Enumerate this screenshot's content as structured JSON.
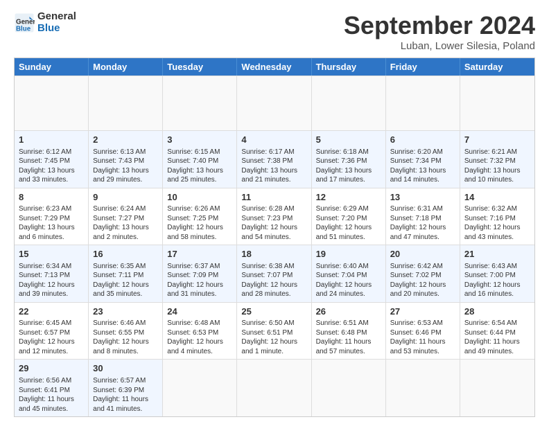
{
  "logo": {
    "line1": "General",
    "line2": "Blue"
  },
  "title": "September 2024",
  "location": "Luban, Lower Silesia, Poland",
  "headers": [
    "Sunday",
    "Monday",
    "Tuesday",
    "Wednesday",
    "Thursday",
    "Friday",
    "Saturday"
  ],
  "rows": [
    [
      {
        "empty": true
      },
      {
        "empty": true
      },
      {
        "empty": true
      },
      {
        "empty": true
      },
      {
        "empty": true
      },
      {
        "empty": true
      },
      {
        "empty": true
      }
    ],
    [
      {
        "day": "1",
        "lines": [
          "Sunrise: 6:12 AM",
          "Sunset: 7:45 PM",
          "Daylight: 13 hours",
          "and 33 minutes."
        ]
      },
      {
        "day": "2",
        "lines": [
          "Sunrise: 6:13 AM",
          "Sunset: 7:43 PM",
          "Daylight: 13 hours",
          "and 29 minutes."
        ]
      },
      {
        "day": "3",
        "lines": [
          "Sunrise: 6:15 AM",
          "Sunset: 7:40 PM",
          "Daylight: 13 hours",
          "and 25 minutes."
        ]
      },
      {
        "day": "4",
        "lines": [
          "Sunrise: 6:17 AM",
          "Sunset: 7:38 PM",
          "Daylight: 13 hours",
          "and 21 minutes."
        ]
      },
      {
        "day": "5",
        "lines": [
          "Sunrise: 6:18 AM",
          "Sunset: 7:36 PM",
          "Daylight: 13 hours",
          "and 17 minutes."
        ]
      },
      {
        "day": "6",
        "lines": [
          "Sunrise: 6:20 AM",
          "Sunset: 7:34 PM",
          "Daylight: 13 hours",
          "and 14 minutes."
        ]
      },
      {
        "day": "7",
        "lines": [
          "Sunrise: 6:21 AM",
          "Sunset: 7:32 PM",
          "Daylight: 13 hours",
          "and 10 minutes."
        ]
      }
    ],
    [
      {
        "day": "8",
        "lines": [
          "Sunrise: 6:23 AM",
          "Sunset: 7:29 PM",
          "Daylight: 13 hours",
          "and 6 minutes."
        ]
      },
      {
        "day": "9",
        "lines": [
          "Sunrise: 6:24 AM",
          "Sunset: 7:27 PM",
          "Daylight: 13 hours",
          "and 2 minutes."
        ]
      },
      {
        "day": "10",
        "lines": [
          "Sunrise: 6:26 AM",
          "Sunset: 7:25 PM",
          "Daylight: 12 hours",
          "and 58 minutes."
        ]
      },
      {
        "day": "11",
        "lines": [
          "Sunrise: 6:28 AM",
          "Sunset: 7:23 PM",
          "Daylight: 12 hours",
          "and 54 minutes."
        ]
      },
      {
        "day": "12",
        "lines": [
          "Sunrise: 6:29 AM",
          "Sunset: 7:20 PM",
          "Daylight: 12 hours",
          "and 51 minutes."
        ]
      },
      {
        "day": "13",
        "lines": [
          "Sunrise: 6:31 AM",
          "Sunset: 7:18 PM",
          "Daylight: 12 hours",
          "and 47 minutes."
        ]
      },
      {
        "day": "14",
        "lines": [
          "Sunrise: 6:32 AM",
          "Sunset: 7:16 PM",
          "Daylight: 12 hours",
          "and 43 minutes."
        ]
      }
    ],
    [
      {
        "day": "15",
        "lines": [
          "Sunrise: 6:34 AM",
          "Sunset: 7:13 PM",
          "Daylight: 12 hours",
          "and 39 minutes."
        ]
      },
      {
        "day": "16",
        "lines": [
          "Sunrise: 6:35 AM",
          "Sunset: 7:11 PM",
          "Daylight: 12 hours",
          "and 35 minutes."
        ]
      },
      {
        "day": "17",
        "lines": [
          "Sunrise: 6:37 AM",
          "Sunset: 7:09 PM",
          "Daylight: 12 hours",
          "and 31 minutes."
        ]
      },
      {
        "day": "18",
        "lines": [
          "Sunrise: 6:38 AM",
          "Sunset: 7:07 PM",
          "Daylight: 12 hours",
          "and 28 minutes."
        ]
      },
      {
        "day": "19",
        "lines": [
          "Sunrise: 6:40 AM",
          "Sunset: 7:04 PM",
          "Daylight: 12 hours",
          "and 24 minutes."
        ]
      },
      {
        "day": "20",
        "lines": [
          "Sunrise: 6:42 AM",
          "Sunset: 7:02 PM",
          "Daylight: 12 hours",
          "and 20 minutes."
        ]
      },
      {
        "day": "21",
        "lines": [
          "Sunrise: 6:43 AM",
          "Sunset: 7:00 PM",
          "Daylight: 12 hours",
          "and 16 minutes."
        ]
      }
    ],
    [
      {
        "day": "22",
        "lines": [
          "Sunrise: 6:45 AM",
          "Sunset: 6:57 PM",
          "Daylight: 12 hours",
          "and 12 minutes."
        ]
      },
      {
        "day": "23",
        "lines": [
          "Sunrise: 6:46 AM",
          "Sunset: 6:55 PM",
          "Daylight: 12 hours",
          "and 8 minutes."
        ]
      },
      {
        "day": "24",
        "lines": [
          "Sunrise: 6:48 AM",
          "Sunset: 6:53 PM",
          "Daylight: 12 hours",
          "and 4 minutes."
        ]
      },
      {
        "day": "25",
        "lines": [
          "Sunrise: 6:50 AM",
          "Sunset: 6:51 PM",
          "Daylight: 12 hours",
          "and 1 minute."
        ]
      },
      {
        "day": "26",
        "lines": [
          "Sunrise: 6:51 AM",
          "Sunset: 6:48 PM",
          "Daylight: 11 hours",
          "and 57 minutes."
        ]
      },
      {
        "day": "27",
        "lines": [
          "Sunrise: 6:53 AM",
          "Sunset: 6:46 PM",
          "Daylight: 11 hours",
          "and 53 minutes."
        ]
      },
      {
        "day": "28",
        "lines": [
          "Sunrise: 6:54 AM",
          "Sunset: 6:44 PM",
          "Daylight: 11 hours",
          "and 49 minutes."
        ]
      }
    ],
    [
      {
        "day": "29",
        "lines": [
          "Sunrise: 6:56 AM",
          "Sunset: 6:41 PM",
          "Daylight: 11 hours",
          "and 45 minutes."
        ]
      },
      {
        "day": "30",
        "lines": [
          "Sunrise: 6:57 AM",
          "Sunset: 6:39 PM",
          "Daylight: 11 hours",
          "and 41 minutes."
        ]
      },
      {
        "empty": true
      },
      {
        "empty": true
      },
      {
        "empty": true
      },
      {
        "empty": true
      },
      {
        "empty": true
      }
    ]
  ]
}
